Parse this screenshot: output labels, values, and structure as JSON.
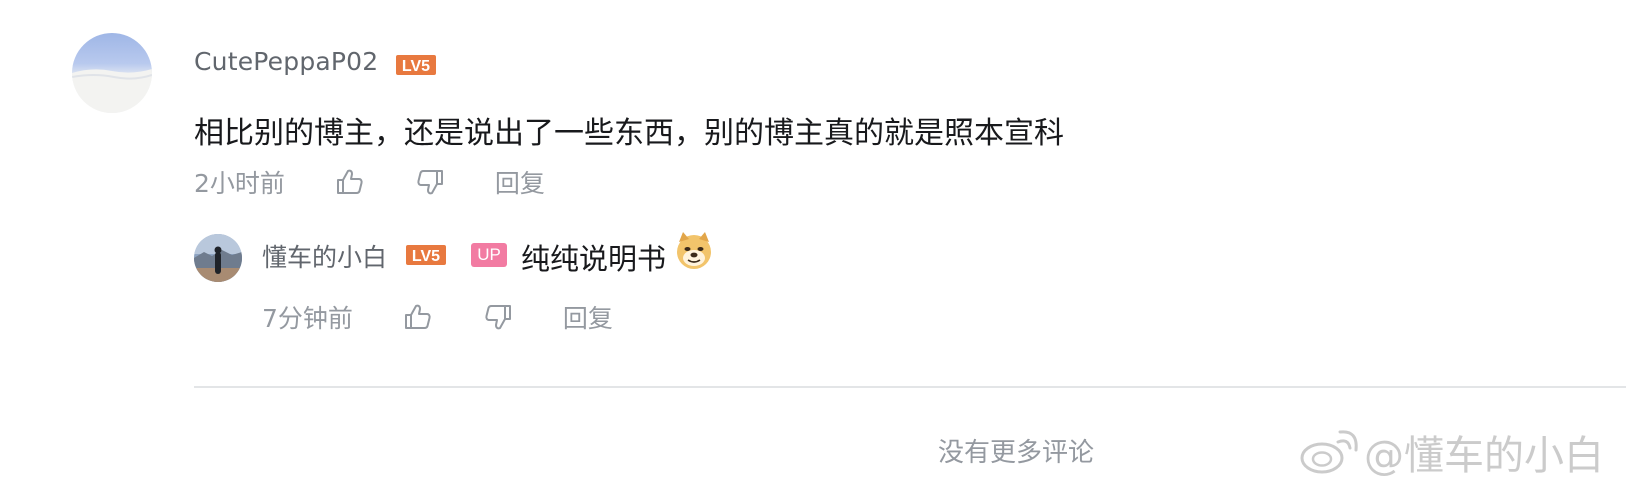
{
  "comment": {
    "username": "CutePeppaP02",
    "level": "LV5",
    "text": "相比别的博主，还是说出了一些东西，别的博主真的就是照本宣科",
    "time": "2小时前",
    "reply_label": "回复"
  },
  "reply": {
    "username": "懂车的小白",
    "level": "LV5",
    "up_badge": "UP",
    "text": "纯纯说明书",
    "emoji": "doge-emoji",
    "time": "7分钟前",
    "reply_label": "回复"
  },
  "footer": {
    "no_more": "没有更多评论"
  },
  "watermark": {
    "text": "@懂车的小白"
  },
  "colors": {
    "level_badge": "#e8793f",
    "up_badge": "#f27ba2",
    "meta_text": "#9499a0",
    "username": "#61666d"
  },
  "icons": [
    "like-icon",
    "dislike-icon",
    "weibo-icon"
  ]
}
